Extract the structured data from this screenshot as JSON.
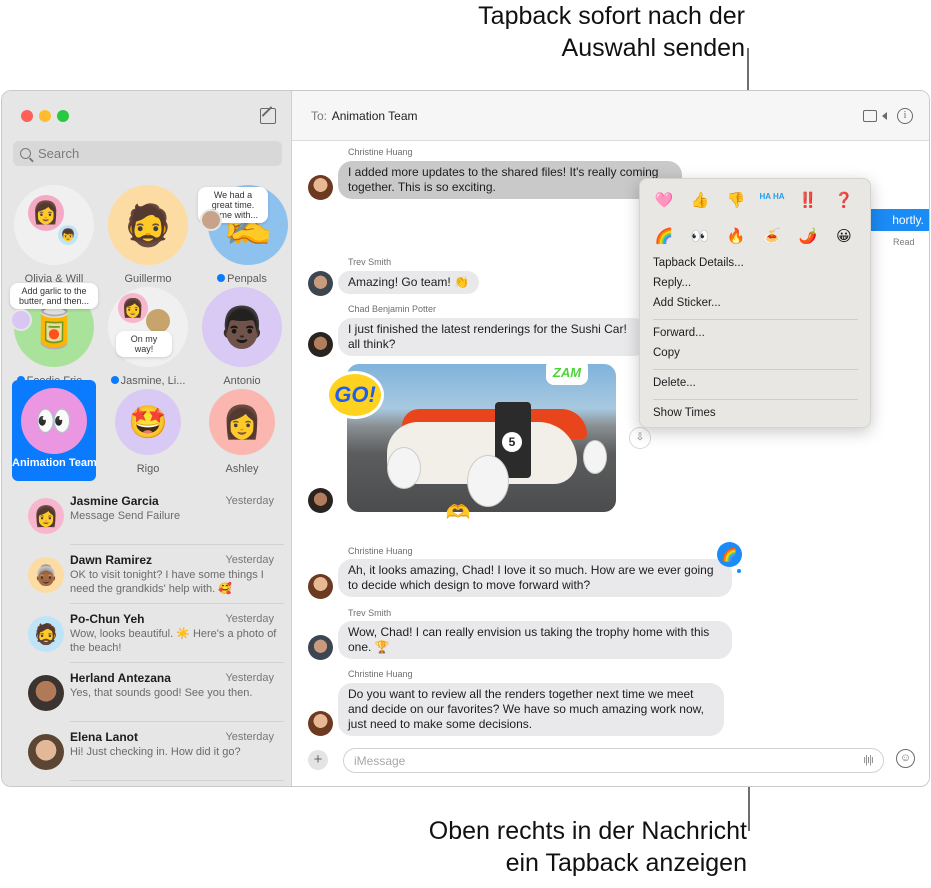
{
  "callouts": {
    "top_line1": "Tapback sofort nach der",
    "top_line2": "Auswahl senden",
    "bottom_line1": "Oben rechts in der Nachricht",
    "bottom_line2": "ein Tapback anzeigen"
  },
  "window": {
    "traffic_lights": {
      "close": "#fe5f57",
      "minimize": "#febc2e",
      "zoom": "#28c840"
    },
    "accent": "#0a7aff"
  },
  "sidebar": {
    "search_placeholder": "Search",
    "pinned": [
      {
        "label": "Olivia & Will",
        "unread": false
      },
      {
        "label": "Guillermo",
        "unread": false
      },
      {
        "label": "Penpals",
        "unread": true,
        "bubble": "We had a great time. Home with..."
      },
      {
        "label": "Foodie Frie...",
        "unread": true,
        "bubble": "Add garlic to the butter, and then..."
      },
      {
        "label": "Jasmine, Li...",
        "unread": true,
        "bubble": "On my way!"
      },
      {
        "label": "Antonio",
        "unread": false
      },
      {
        "label": "Animation Team",
        "unread": false,
        "selected": true
      },
      {
        "label": "Rigo",
        "unread": false
      },
      {
        "label": "Ashley",
        "unread": false
      }
    ],
    "conversations": [
      {
        "name": "Jasmine Garcia",
        "time": "Yesterday",
        "preview": "Message Send Failure"
      },
      {
        "name": "Dawn Ramirez",
        "time": "Yesterday",
        "preview": "OK to visit tonight? I have some things I need the grandkids' help with. 🥰"
      },
      {
        "name": "Po-Chun Yeh",
        "time": "Yesterday",
        "preview": "Wow, looks beautiful. ☀️ Here's a photo of the beach!"
      },
      {
        "name": "Herland Antezana",
        "time": "Yesterday",
        "preview": "Yes, that sounds good! See you then."
      },
      {
        "name": "Elena Lanot",
        "time": "Yesterday",
        "preview": "Hi! Just checking in. How did it go?"
      }
    ]
  },
  "chat": {
    "to_label": "To:",
    "recipient": "Animation Team",
    "messages": [
      {
        "sender": "Christine Huang",
        "text": "I added more updates to the shared files! It's really coming together. This is so exciting."
      },
      {
        "sender": "Trev Smith",
        "text": "Amazing! Go team! 👏"
      },
      {
        "sender": "Chad Benjamin Potter",
        "text": "I just finished the latest renderings for the Sushi Car! all think?"
      },
      {
        "sender": "Christine Huang",
        "text": "Ah, it looks amazing, Chad! I love it so much. How are we ever going to decide which design to move forward with?",
        "tapback": "🌈"
      },
      {
        "sender": "Trev Smith",
        "text": "Wow, Chad! I can really envision us taking the trophy home with this one. 🏆"
      },
      {
        "sender": "Christine Huang",
        "text": "Do you want to review all the renders together next time we meet and decide on our favorites? We have so much amazing work now, just need to make some decisions."
      }
    ],
    "sent_partial": "hortly.",
    "read_receipt": "Read",
    "photo": {
      "car_number": "5",
      "stickers": [
        "GO!",
        "ZAM",
        "🫶"
      ]
    },
    "composer_placeholder": "iMessage"
  },
  "context_menu": {
    "tapbacks_row1": [
      "🩷",
      "👍",
      "👎",
      "HA HA",
      "‼️",
      "❓"
    ],
    "tapbacks_row2": [
      "🌈",
      "👀",
      "🔥",
      "🍝",
      "🌶️",
      "😀"
    ],
    "items_group1": [
      "Tapback Details...",
      "Reply...",
      "Add Sticker..."
    ],
    "items_group2": [
      "Forward...",
      "Copy"
    ],
    "items_group3": [
      "Delete..."
    ],
    "items_group4": [
      "Show Times"
    ]
  }
}
